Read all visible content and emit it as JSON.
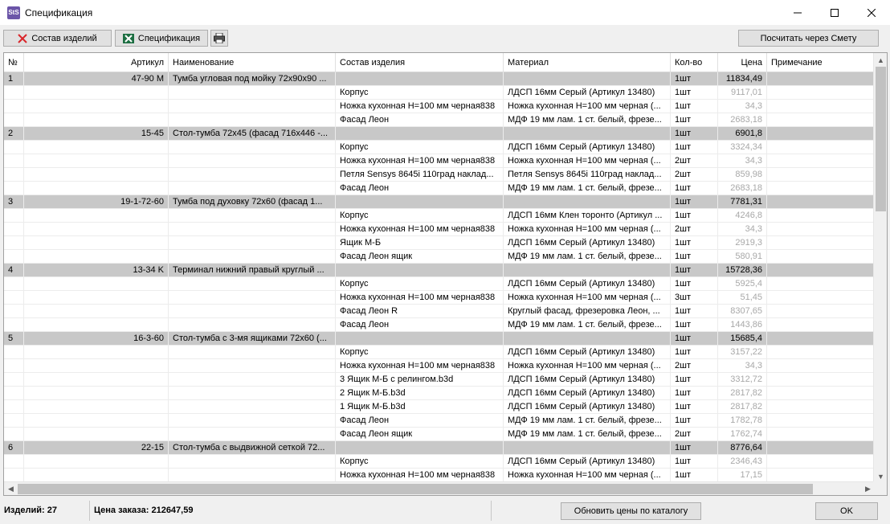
{
  "window": {
    "title": "Спецификация",
    "app_icon_text": "StS"
  },
  "toolbar": {
    "items_composition_label": "Состав изделий",
    "specification_label": "Спецификация",
    "calc_estimate_label": "Посчитать через Смету"
  },
  "table": {
    "headers": [
      "№",
      "Артикул",
      "Наименование",
      "Состав изделия",
      "Материал",
      "Кол-во",
      "Цена",
      "Примечание"
    ],
    "rows": [
      {
        "type": "group",
        "num": "1",
        "article": "47-90 M",
        "name": "Тумба угловая под мойку 72x90x90 ...",
        "part": "",
        "material": "",
        "qty": "1шт",
        "price": "11834,49",
        "note": ""
      },
      {
        "type": "item",
        "num": "",
        "article": "",
        "name": "",
        "part": "Корпус",
        "material": "ЛДСП 16мм Серый (Артикул 13480)",
        "qty": "1шт",
        "price": "9117,01",
        "note": ""
      },
      {
        "type": "item",
        "num": "",
        "article": "",
        "name": "",
        "part": "Ножка кухонная H=100 мм черная838",
        "material": "Ножка кухонная H=100 мм черная (...",
        "qty": "1шт",
        "price": "34,3",
        "note": ""
      },
      {
        "type": "item",
        "num": "",
        "article": "",
        "name": "",
        "part": "Фасад Леон",
        "material": "МДФ 19 мм лам. 1 ст. белый, фрезе...",
        "qty": "1шт",
        "price": "2683,18",
        "note": ""
      },
      {
        "type": "group",
        "num": "2",
        "article": "15-45",
        "name": "Стол-тумба 72x45 (фасад 716x446 -...",
        "part": "",
        "material": "",
        "qty": "1шт",
        "price": "6901,8",
        "note": ""
      },
      {
        "type": "item",
        "num": "",
        "article": "",
        "name": "",
        "part": "Корпус",
        "material": "ЛДСП 16мм Серый (Артикул 13480)",
        "qty": "1шт",
        "price": "3324,34",
        "note": ""
      },
      {
        "type": "item",
        "num": "",
        "article": "",
        "name": "",
        "part": "Ножка кухонная H=100 мм черная838",
        "material": "Ножка кухонная H=100 мм черная (...",
        "qty": "2шт",
        "price": "34,3",
        "note": ""
      },
      {
        "type": "item",
        "num": "",
        "article": "",
        "name": "",
        "part": "Петля Sensys 8645i 110град наклад...",
        "material": "Петля Sensys 8645i 110град наклад...",
        "qty": "2шт",
        "price": "859,98",
        "note": ""
      },
      {
        "type": "item",
        "num": "",
        "article": "",
        "name": "",
        "part": "Фасад Леон",
        "material": "МДФ 19 мм лам. 1 ст. белый, фрезе...",
        "qty": "1шт",
        "price": "2683,18",
        "note": ""
      },
      {
        "type": "group",
        "num": "3",
        "article": "19-1-72-60",
        "name": "Тумба под духовку 72x60 (фасад 1...",
        "part": "",
        "material": "",
        "qty": "1шт",
        "price": "7781,31",
        "note": ""
      },
      {
        "type": "item",
        "num": "",
        "article": "",
        "name": "",
        "part": "Корпус",
        "material": "ЛДСП 16мм Клен торонто (Артикул ...",
        "qty": "1шт",
        "price": "4246,8",
        "note": ""
      },
      {
        "type": "item",
        "num": "",
        "article": "",
        "name": "",
        "part": "Ножка кухонная H=100 мм черная838",
        "material": "Ножка кухонная H=100 мм черная (...",
        "qty": "2шт",
        "price": "34,3",
        "note": ""
      },
      {
        "type": "item",
        "num": "",
        "article": "",
        "name": "",
        "part": "Ящик М-Б",
        "material": "ЛДСП 16мм Серый (Артикул 13480)",
        "qty": "1шт",
        "price": "2919,3",
        "note": ""
      },
      {
        "type": "item",
        "num": "",
        "article": "",
        "name": "",
        "part": "Фасад Леон ящик",
        "material": "МДФ 19 мм лам. 1 ст. белый, фрезе...",
        "qty": "1шт",
        "price": "580,91",
        "note": ""
      },
      {
        "type": "group",
        "num": "4",
        "article": "13-34 K",
        "name": "Терминал нижний правый круглый ...",
        "part": "",
        "material": "",
        "qty": "1шт",
        "price": "15728,36",
        "note": ""
      },
      {
        "type": "item",
        "num": "",
        "article": "",
        "name": "",
        "part": "Корпус",
        "material": "ЛДСП 16мм Серый (Артикул 13480)",
        "qty": "1шт",
        "price": "5925,4",
        "note": ""
      },
      {
        "type": "item",
        "num": "",
        "article": "",
        "name": "",
        "part": "Ножка кухонная H=100 мм черная838",
        "material": "Ножка кухонная H=100 мм черная (...",
        "qty": "3шт",
        "price": "51,45",
        "note": ""
      },
      {
        "type": "item",
        "num": "",
        "article": "",
        "name": "",
        "part": "Фасад Леон R",
        "material": "Круглый фасад, фрезеровка Леон, ...",
        "qty": "1шт",
        "price": "8307,65",
        "note": ""
      },
      {
        "type": "item",
        "num": "",
        "article": "",
        "name": "",
        "part": "Фасад Леон",
        "material": "МДФ 19 мм лам. 1 ст. белый, фрезе...",
        "qty": "1шт",
        "price": "1443,86",
        "note": ""
      },
      {
        "type": "group",
        "num": "5",
        "article": "16-3-60",
        "name": "Стол-тумба с 3-мя ящиками 72x60 (...",
        "part": "",
        "material": "",
        "qty": "1шт",
        "price": "15685,4",
        "note": ""
      },
      {
        "type": "item",
        "num": "",
        "article": "",
        "name": "",
        "part": "Корпус",
        "material": "ЛДСП 16мм Серый (Артикул 13480)",
        "qty": "1шт",
        "price": "3157,22",
        "note": ""
      },
      {
        "type": "item",
        "num": "",
        "article": "",
        "name": "",
        "part": "Ножка кухонная H=100 мм черная838",
        "material": "Ножка кухонная H=100 мм черная (...",
        "qty": "2шт",
        "price": "34,3",
        "note": ""
      },
      {
        "type": "item",
        "num": "",
        "article": "",
        "name": "",
        "part": "3 Ящик М-Б с релингом.b3d",
        "material": "ЛДСП 16мм Серый (Артикул 13480)",
        "qty": "1шт",
        "price": "3312,72",
        "note": ""
      },
      {
        "type": "item",
        "num": "",
        "article": "",
        "name": "",
        "part": "2 Ящик М-Б.b3d",
        "material": "ЛДСП 16мм Серый (Артикул 13480)",
        "qty": "1шт",
        "price": "2817,82",
        "note": ""
      },
      {
        "type": "item",
        "num": "",
        "article": "",
        "name": "",
        "part": "1 Ящик М-Б.b3d",
        "material": "ЛДСП 16мм Серый (Артикул 13480)",
        "qty": "1шт",
        "price": "2817,82",
        "note": ""
      },
      {
        "type": "item",
        "num": "",
        "article": "",
        "name": "",
        "part": "Фасад Леон",
        "material": "МДФ 19 мм лам. 1 ст. белый, фрезе...",
        "qty": "1шт",
        "price": "1782,78",
        "note": ""
      },
      {
        "type": "item",
        "num": "",
        "article": "",
        "name": "",
        "part": "Фасад Леон ящик",
        "material": "МДФ 19 мм лам. 1 ст. белый, фрезе...",
        "qty": "2шт",
        "price": "1762,74",
        "note": ""
      },
      {
        "type": "group",
        "num": "6",
        "article": "22-15",
        "name": "Стол-тумба с выдвижной сеткой 72...",
        "part": "",
        "material": "",
        "qty": "1шт",
        "price": "8776,64",
        "note": ""
      },
      {
        "type": "item",
        "num": "",
        "article": "",
        "name": "",
        "part": "Корпус",
        "material": "ЛДСП 16мм Серый (Артикул 13480)",
        "qty": "1шт",
        "price": "2346,43",
        "note": ""
      },
      {
        "type": "item",
        "num": "",
        "article": "",
        "name": "",
        "part": "Ножка кухонная H=100 мм черная838",
        "material": "Ножка кухонная H=100 мм черная (...",
        "qty": "1шт",
        "price": "17,15",
        "note": ""
      }
    ]
  },
  "status": {
    "items_count": "Изделий: 27",
    "order_price": "Цена заказа: 212647,59",
    "update_prices_label": "Обновить цены по  каталогу",
    "ok_label": "OK"
  },
  "colors": {
    "group_row_bg": "#c8c8c8",
    "subitem_price": "#a8a8a8",
    "delete_icon": "#d9262b",
    "excel_icon": "#1d6f42"
  }
}
